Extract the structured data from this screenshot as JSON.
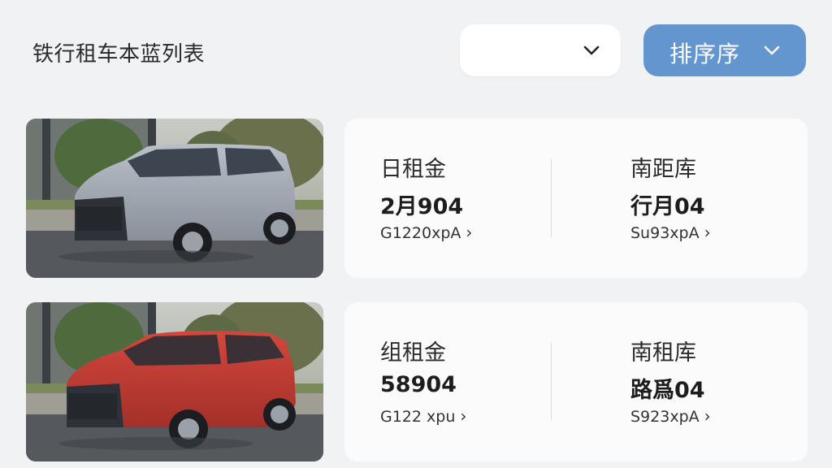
{
  "header": {
    "title": "铁行租车本蓝列表",
    "filter": {
      "value": "",
      "icon": "chevron-down-icon"
    },
    "sort": {
      "label": "排序序",
      "icon": "chevron-down-icon",
      "color": "#6396cf"
    }
  },
  "listings": [
    {
      "car_color": "silver-gray",
      "columns": [
        {
          "label": "日租金",
          "value": "2月904",
          "link": "G1220xpA"
        },
        {
          "label": "南距库",
          "value": "行月04",
          "link": "Su93xpA"
        }
      ]
    },
    {
      "car_color": "red",
      "columns": [
        {
          "label": "组租金",
          "value": "58904",
          "link": "G122 xpu"
        },
        {
          "label": "南租库",
          "value": "路爲04",
          "link": "S923xpA"
        }
      ]
    }
  ]
}
